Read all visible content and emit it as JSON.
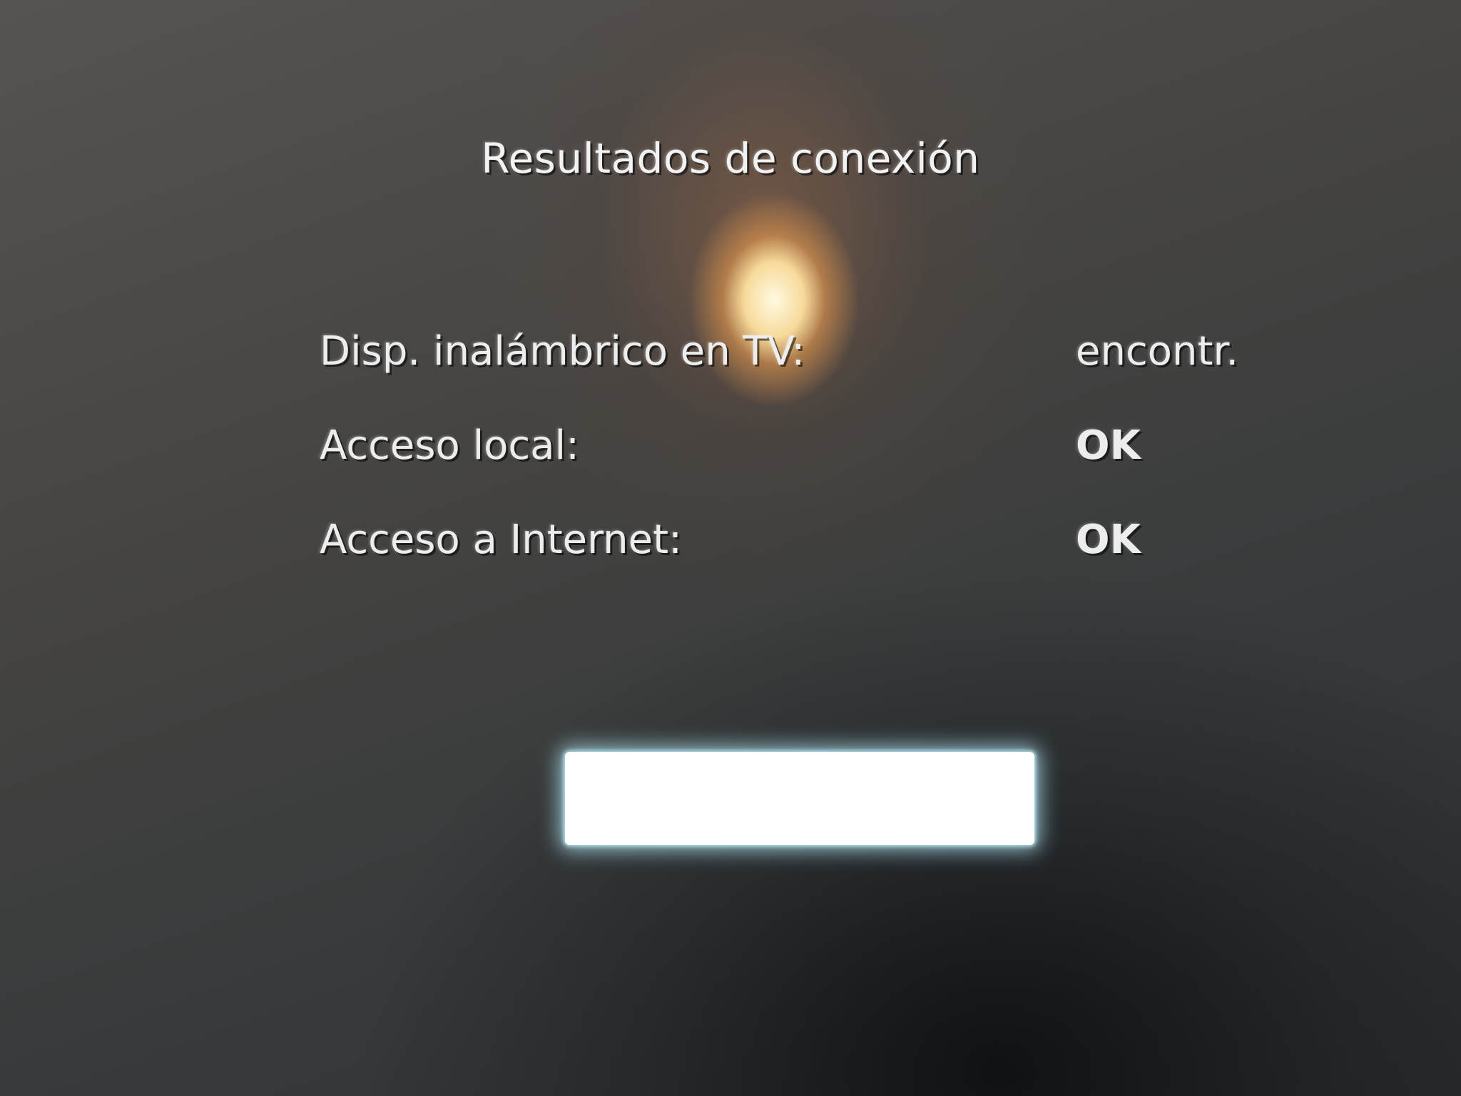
{
  "dialog": {
    "title": "Resultados de conexión",
    "rows": [
      {
        "label": "Disp. inalámbrico en TV:",
        "value": "encontr."
      },
      {
        "label": "Acceso local:",
        "value": "OK"
      },
      {
        "label": "Acceso a Internet:",
        "value": "OK"
      }
    ],
    "button_label": ""
  }
}
